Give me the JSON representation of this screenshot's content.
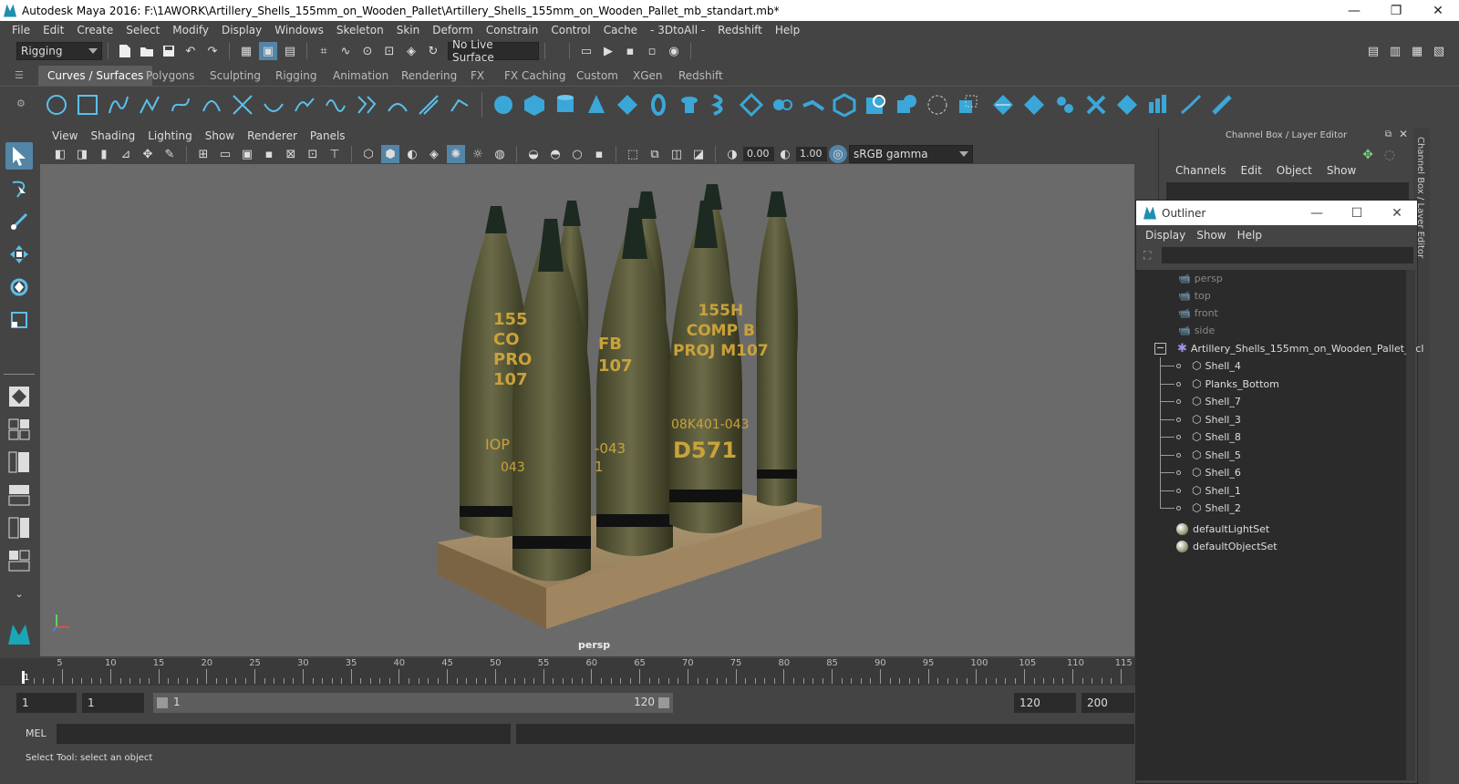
{
  "window": {
    "title": "Autodesk Maya 2016: F:\\1AWORK\\Artillery_Shells_155mm_on_Wooden_Pallet\\Artillery_Shells_155mm_on_Wooden_Pallet_mb_standart.mb*",
    "minimize": "—",
    "maximize": "❐",
    "close": "✕"
  },
  "menubar": [
    "File",
    "Edit",
    "Create",
    "Select",
    "Modify",
    "Display",
    "Windows",
    "Skeleton",
    "Skin",
    "Deform",
    "Constrain",
    "Control",
    "Cache",
    "- 3DtoAll -",
    "Redshift",
    "Help"
  ],
  "statusline": {
    "menuset": "Rigging",
    "live_surface": "No Live Surface"
  },
  "shelf_tabs": [
    "Curves / Surfaces",
    "Polygons",
    "Sculpting",
    "Rigging",
    "Animation",
    "Rendering",
    "FX",
    "FX Caching",
    "Custom",
    "XGen",
    "Redshift"
  ],
  "panel_menu": [
    "View",
    "Shading",
    "Lighting",
    "Show",
    "Renderer",
    "Panels"
  ],
  "panel_toolbar": {
    "exposure": "0.00",
    "gamma": "1.00",
    "color_space": "sRGB gamma"
  },
  "viewport": {
    "camera": "persp",
    "shells": [
      {
        "line1": "155",
        "line2": "CO",
        "line3": "PRO",
        "line4": "107",
        "lot": "IOP",
        "code": "043"
      },
      {
        "line1": "",
        "line2": "",
        "line3": "",
        "line4": "",
        "lot": "",
        "code": ""
      },
      {
        "line1": "",
        "line2": "FB",
        "line3": "107",
        "line4": "",
        "lot": "",
        "code": ""
      },
      {
        "line1": "",
        "line2": "",
        "line3": "",
        "line4": "",
        "lot": "-043",
        "code": "1"
      },
      {
        "line1": "155H",
        "line2": "COMP B",
        "line3": "PROJ  M107",
        "line4": "",
        "lot": "08K401-043",
        "code": "D571"
      }
    ]
  },
  "timeline": {
    "ticks": [
      "5",
      "10",
      "15",
      "20",
      "25",
      "30",
      "35",
      "40",
      "45",
      "50",
      "55",
      "60",
      "65",
      "70",
      "75",
      "80",
      "85",
      "90",
      "95",
      "100",
      "105",
      "110",
      "115"
    ],
    "current_frame": "1"
  },
  "range": {
    "start": "1",
    "playback_start": "1",
    "slider_start": "1",
    "slider_end": "120",
    "playback_end": "120",
    "end": "200"
  },
  "cmdline": {
    "label": "MEL"
  },
  "helpline": "Select Tool: select an object",
  "channelbox": {
    "title": "Channel Box / Layer Editor",
    "menu": [
      "Channels",
      "Edit",
      "Object",
      "Show"
    ],
    "side_label": "Channel Box / Layer Editor"
  },
  "outliner": {
    "title": "Outliner",
    "menu": [
      "Display",
      "Show",
      "Help"
    ],
    "cameras": [
      "persp",
      "top",
      "front",
      "side"
    ],
    "group": "Artillery_Shells_155mm_on_Wooden_Pallet_ncl",
    "children": [
      "Shell_4",
      "Planks_Bottom",
      "Shell_7",
      "Shell_3",
      "Shell_8",
      "Shell_5",
      "Shell_6",
      "Shell_1",
      "Shell_2"
    ],
    "sets": [
      "defaultLightSet",
      "defaultObjectSet"
    ]
  }
}
